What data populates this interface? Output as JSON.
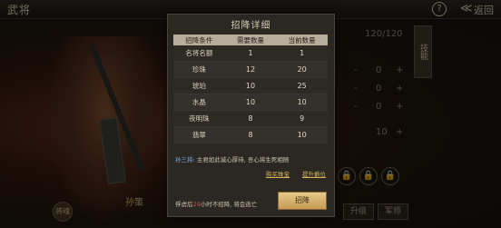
{
  "topbar": {
    "title": "武将",
    "help": "?",
    "back_label": "返回"
  },
  "background": {
    "right_panel": {
      "top_value": "120/120",
      "rows": [
        {
          "left": "-",
          "value": "0",
          "right": "+"
        },
        {
          "left": "-",
          "value": "0",
          "right": "+"
        },
        {
          "left": "-",
          "value": "0",
          "right": "+"
        },
        {
          "left": "",
          "value": "10",
          "right": "+"
        }
      ],
      "vertical_tab": "技能",
      "locks": [
        "🔒",
        "🔒",
        "🔒"
      ],
      "bottom_buttons": [
        "升级",
        "军师"
      ]
    },
    "character_name": "孙策",
    "badge": "将魂"
  },
  "modal": {
    "title": "招降详细",
    "table": {
      "headers": [
        "招降条件",
        "需要数量",
        "当前数量"
      ],
      "rows": [
        {
          "condition": "名将名额",
          "required": "1",
          "current": "1"
        },
        {
          "condition": "珍珠",
          "required": "12",
          "current": "20"
        },
        {
          "condition": "琥珀",
          "required": "10",
          "current": "25"
        },
        {
          "condition": "水晶",
          "required": "10",
          "current": "10"
        },
        {
          "condition": "夜明珠",
          "required": "8",
          "current": "9"
        },
        {
          "condition": "翡翠",
          "required": "8",
          "current": "10"
        }
      ]
    },
    "quote": {
      "speaker": "孙三将:",
      "text": "主君如此诚心厚待, 吾心将生死相随"
    },
    "links": [
      "购买珠宝",
      "提升爵位"
    ],
    "footer": {
      "prefix": "俘虏后",
      "hours": "24",
      "suffix": "小时不招降, 将会逃亡"
    },
    "recruit_button": "招降"
  }
}
